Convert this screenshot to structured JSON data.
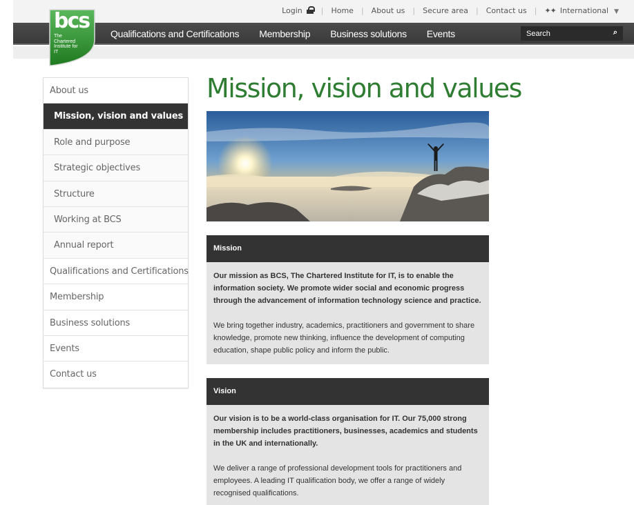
{
  "logo": {
    "text": "bcs",
    "subtitle": "The Chartered Institute for IT",
    "color": "#2e8b2e"
  },
  "utility": {
    "login": "Login",
    "home": "Home",
    "about": "About us",
    "secure": "Secure area",
    "contact": "Contact us",
    "international": "International"
  },
  "nav": {
    "items": [
      "Qualifications and Certifications",
      "Membership",
      "Business solutions",
      "Events"
    ],
    "search_placeholder": "Search"
  },
  "sidebar": {
    "items": [
      {
        "label": "About us",
        "level": "top",
        "active": false
      },
      {
        "label": "Mission, vision and values",
        "level": "sub",
        "active": true
      },
      {
        "label": "Role and purpose",
        "level": "sub",
        "active": false
      },
      {
        "label": "Strategic objectives",
        "level": "sub",
        "active": false
      },
      {
        "label": "Structure",
        "level": "sub",
        "active": false
      },
      {
        "label": "Working at BCS",
        "level": "sub",
        "active": false
      },
      {
        "label": "Annual report",
        "level": "sub",
        "active": false
      },
      {
        "label": "Qualifications and Certifications",
        "level": "top",
        "active": false
      },
      {
        "label": "Membership",
        "level": "top",
        "active": false
      },
      {
        "label": "Business solutions",
        "level": "top",
        "active": false
      },
      {
        "label": "Events",
        "level": "top",
        "active": false
      },
      {
        "label": "Contact us",
        "level": "top",
        "active": false
      }
    ]
  },
  "page": {
    "title": "Mission, vision and values",
    "title_color": "#2e7d32"
  },
  "mission": {
    "heading": "Mission",
    "lead": "Our mission as BCS, The Chartered Institute for IT, is to enable the information society. We promote wider social and economic progress through the advancement of information technology science and practice.",
    "body": "We bring together industry, academics, practitioners and government to share knowledge, promote new thinking, influence the development of computing education, shape public policy and inform the public."
  },
  "vision": {
    "heading": "Vision",
    "lead": "Our vision is to be a world-class organisation for IT. Our 75,000 strong membership includes practitioners, businesses, academics and students in the UK and internationally.",
    "body": "We deliver a range of professional development tools for practitioners and employees. A leading IT qualification body, we offer a range of widely recognised qualifications."
  }
}
